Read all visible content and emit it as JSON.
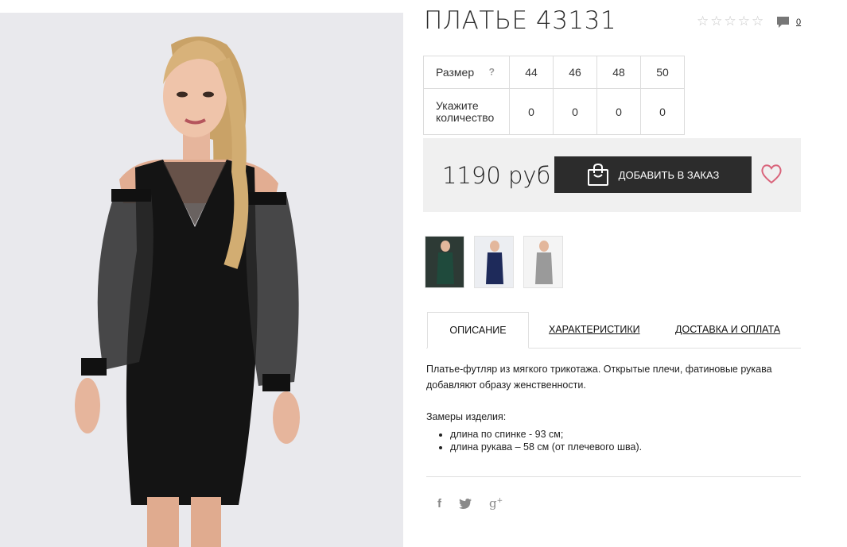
{
  "product": {
    "title": "ПЛАТЬЕ 43131",
    "comments_count": "0",
    "rating": 0,
    "rating_max": 5
  },
  "sizes": {
    "size_label": "Размер",
    "help": "?",
    "qty_label_1": "Укажите",
    "qty_label_2": "количество",
    "values": [
      "44",
      "46",
      "48",
      "50"
    ],
    "quantities": [
      "0",
      "0",
      "0",
      "0"
    ]
  },
  "buy": {
    "price": "1190 руб",
    "add_label": "ДОБАВИТЬ В ЗАКАЗ"
  },
  "thumbnails": {
    "colors": [
      "#1f4a3c",
      "#1e2a5a",
      "#9a9a9a"
    ]
  },
  "tabs": [
    "ОПИСАНИЕ",
    "ХАРАКТЕРИСТИКИ",
    "ДОСТАВКА И ОПЛАТА"
  ],
  "description": {
    "text": "Платье-футляр из мягкого трикотажа. Открытые плечи, фатиновые рукава добавляют образу женственности.",
    "measures_title": "Замеры изделия:",
    "measures": [
      "длина по спинке - 93 см;",
      "длина рукава – 58 см (от плечевого шва)."
    ]
  },
  "social": [
    "f",
    "twitter",
    "g+"
  ],
  "colors": {
    "accent_heart": "#d9637a",
    "button_bg": "#2c2c2c",
    "buybar_bg": "#f0f0f0"
  }
}
